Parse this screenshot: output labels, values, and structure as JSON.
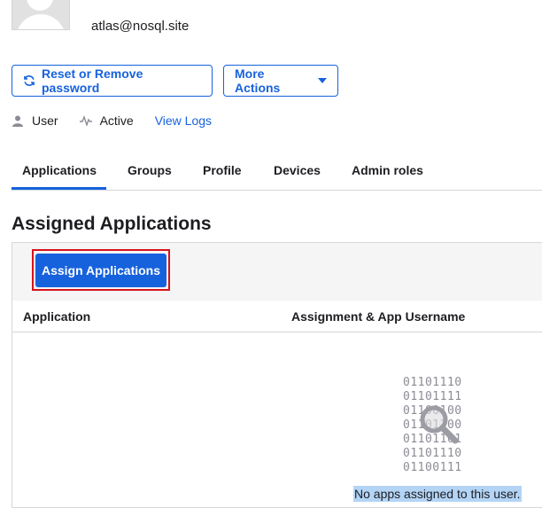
{
  "user": {
    "email": "atlas@nosql.site",
    "type_label": "User",
    "status_label": "Active",
    "view_logs_label": "View Logs"
  },
  "actions": {
    "reset_label": "Reset or Remove password",
    "more_label": "More Actions"
  },
  "tabs": [
    {
      "label": "Applications",
      "active": true
    },
    {
      "label": "Groups",
      "active": false
    },
    {
      "label": "Profile",
      "active": false
    },
    {
      "label": "Devices",
      "active": false
    },
    {
      "label": "Admin roles",
      "active": false
    }
  ],
  "section": {
    "title": "Assigned Applications",
    "assign_button_label": "Assign Applications"
  },
  "table": {
    "columns": [
      "Application",
      "Assignment & App Username"
    ]
  },
  "empty_state": {
    "binary_lines": [
      "01101110",
      "01101111",
      "01100100",
      "01101100",
      "01101101",
      "01101110",
      "01100111"
    ],
    "message": "No apps assigned to this user."
  },
  "colors": {
    "accent": "#1662dd",
    "highlight_border": "#d6131d",
    "selection": "#b3d4f5"
  }
}
